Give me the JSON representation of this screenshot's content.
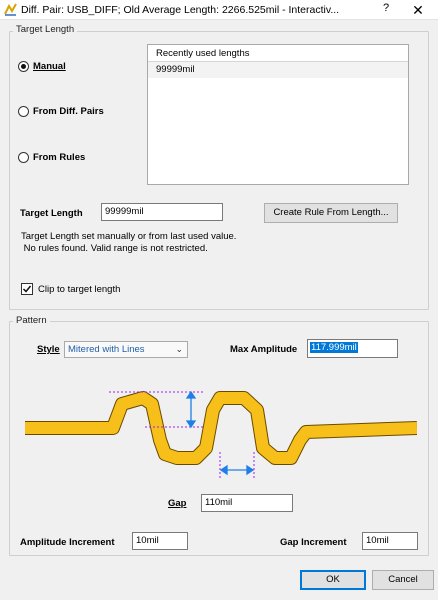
{
  "window": {
    "title": "Diff. Pair: USB_DIFF;  Old Average Length: 2266.525mil - Interactiv...",
    "help_label": "?",
    "close_label": "✕"
  },
  "target_length": {
    "group_label": "Target Length",
    "radio_manual": "Manual",
    "radio_from_diff_pairs": "From Diff. Pairs",
    "radio_from_rules": "From Rules",
    "selected": "Manual",
    "recent_header": "Recently used lengths",
    "recent_items": [
      "99999mil"
    ],
    "target_length_label": "Target Length",
    "target_length_value": "99999mil",
    "create_rule_button": "Create Rule From Length...",
    "info_line1": "Target Length set manually or from last used value.",
    "info_line2": " No rules found. Valid range is not restricted.",
    "clip_label": "Clip to target length",
    "clip_checked": true
  },
  "pattern": {
    "group_label": "Pattern",
    "style_label": "Style",
    "style_value": "Mitered with Lines",
    "max_amplitude_label": "Max Amplitude",
    "max_amplitude_value": "117.999mil",
    "gap_label": "Gap",
    "gap_value": "110mil",
    "amplitude_increment_label": "Amplitude Increment",
    "amplitude_increment_value": "10mil",
    "gap_increment_label": "Gap Increment",
    "gap_increment_value": "10mil"
  },
  "buttons": {
    "ok": "OK",
    "cancel": "Cancel"
  },
  "colors": {
    "trace_fill": "#f6bf1a",
    "trace_outline": "#6b4a00",
    "dimension_arrow": "#1f7fe8",
    "guide_line": "#a020f0",
    "selection": "#0078d7"
  },
  "icons": {
    "app": "app-icon",
    "dropdown": "chevron-down-icon",
    "check": "check-icon"
  }
}
